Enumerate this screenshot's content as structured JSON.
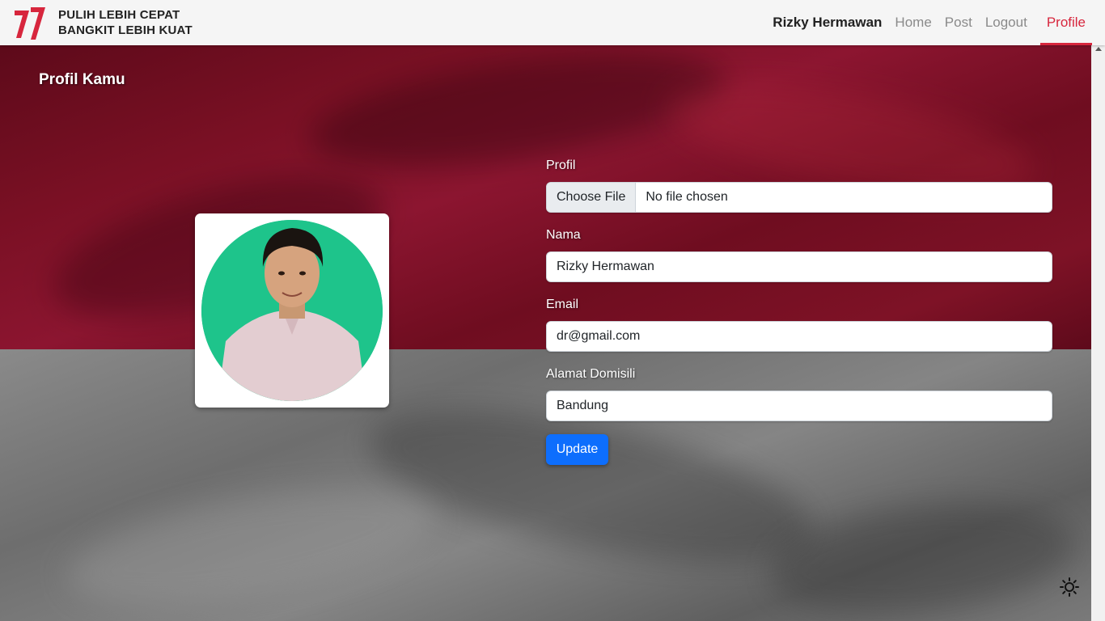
{
  "navbar": {
    "logo_text": "77",
    "brand_line1": "PULIH LEBIH CEPAT",
    "brand_line2": "BANGKIT LEBIH KUAT",
    "user_name": "Rizky Hermawan",
    "links": [
      {
        "label": "Home",
        "active": false
      },
      {
        "label": "Post",
        "active": false
      },
      {
        "label": "Logout",
        "active": false
      },
      {
        "label": "Profile",
        "active": true
      }
    ],
    "accent_color": "#d7263d"
  },
  "page": {
    "title": "Profil Kamu"
  },
  "form": {
    "profile_label": "Profil",
    "file_button": "Choose File",
    "file_status": "No file chosen",
    "name_label": "Nama",
    "name_value": "Rizky Hermawan",
    "email_label": "Email",
    "email_value": "dr@gmail.com",
    "address_label": "Alamat Domisili",
    "address_value": "Bandung",
    "submit_label": "Update",
    "submit_color": "#0d6efd"
  },
  "icons": {
    "theme_toggle": "sun-icon",
    "logo": "logo-77-icon"
  },
  "colors": {
    "flag_red": "#7a1024",
    "flag_grey": "#777777",
    "avatar_bg": "#1ec48b"
  }
}
